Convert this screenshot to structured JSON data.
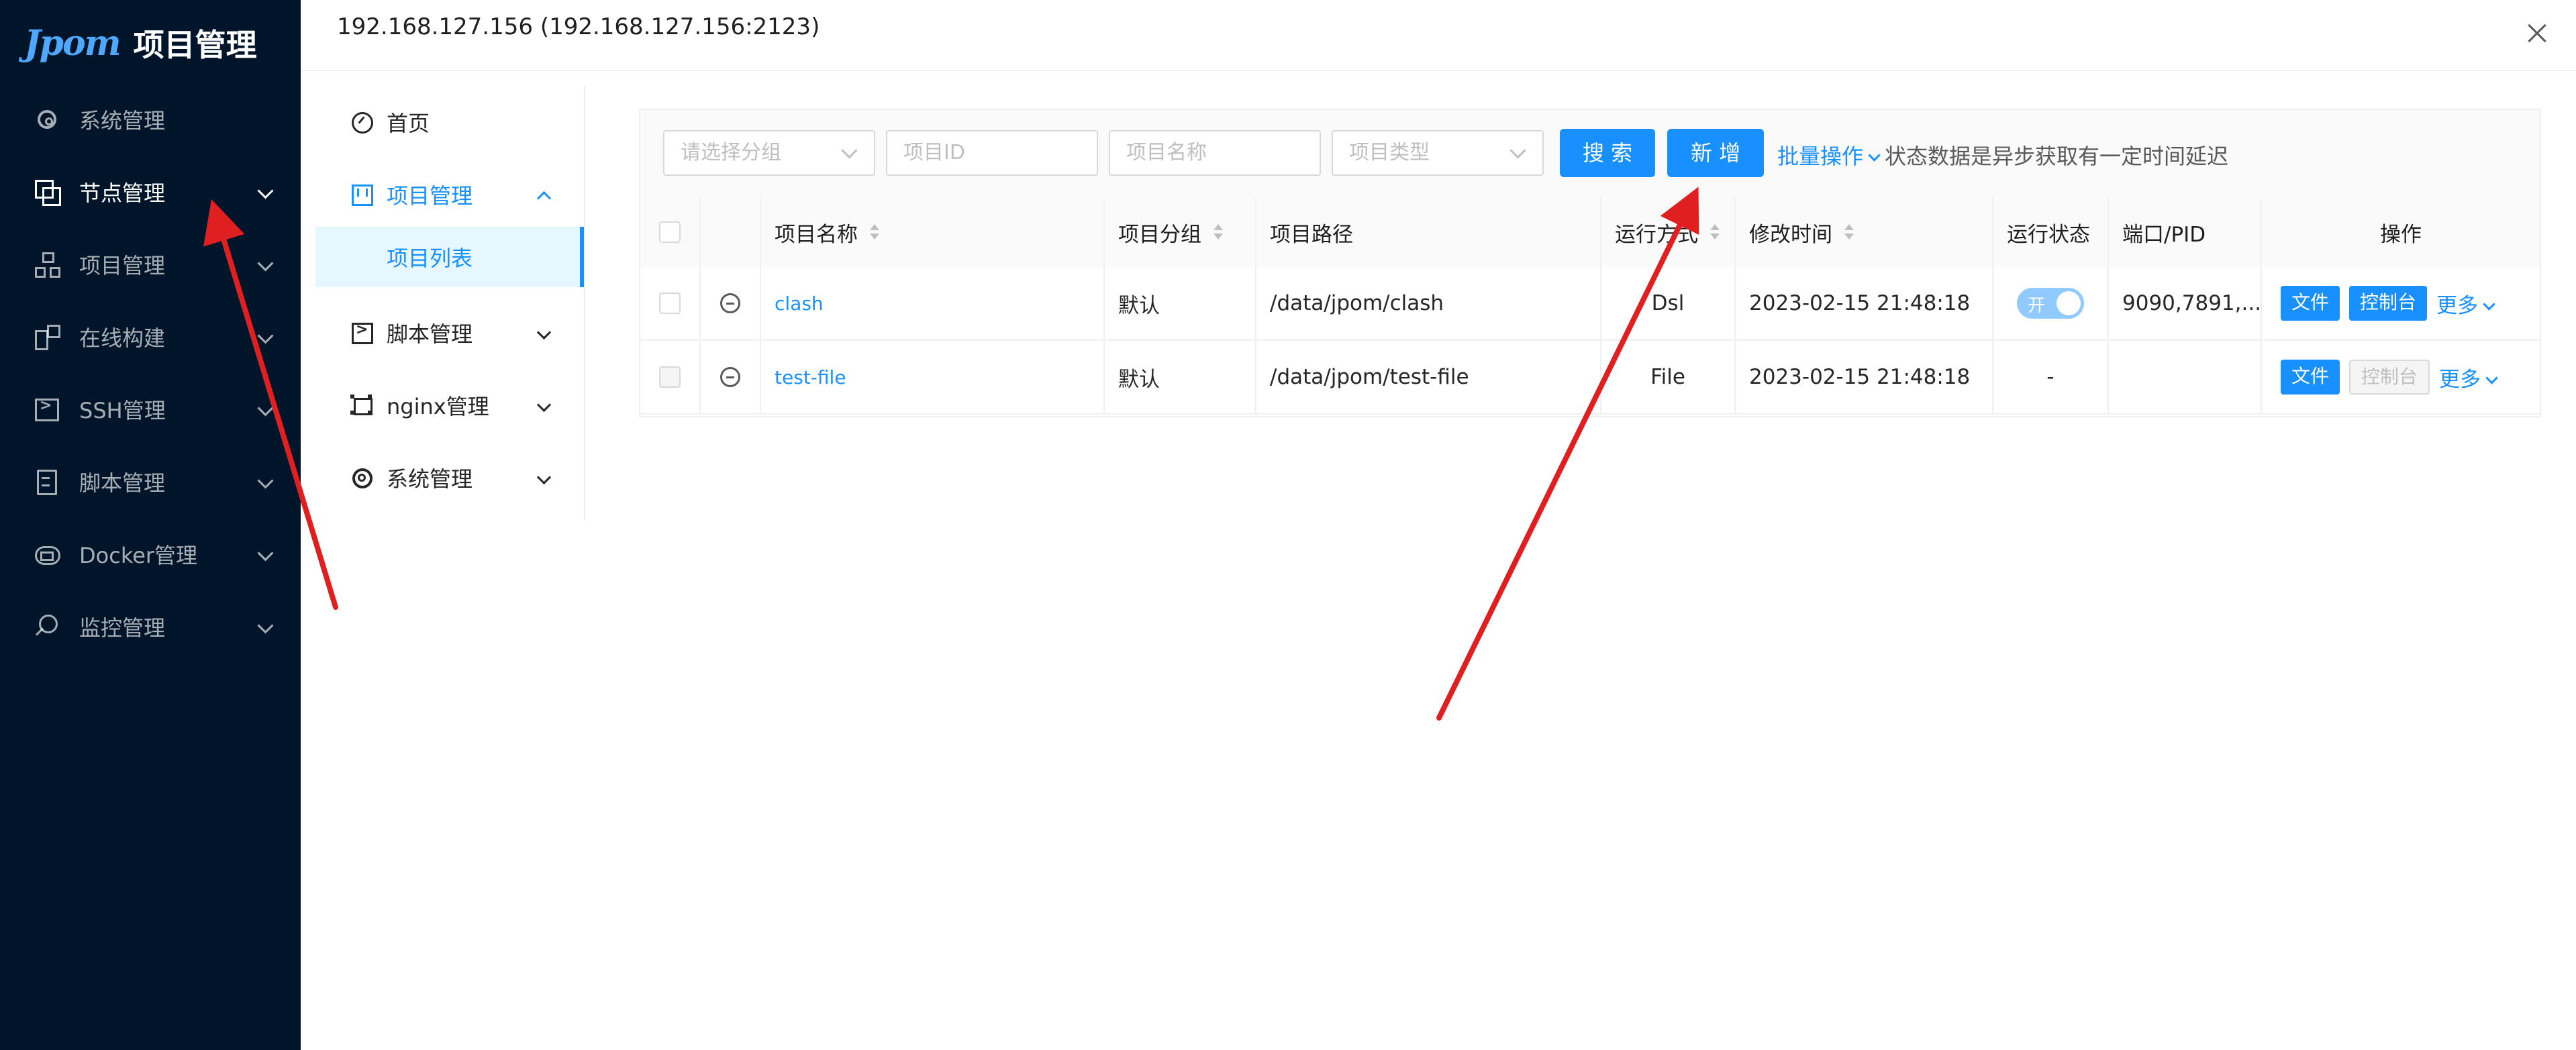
{
  "colors": {
    "sidebar_bg": "#001529",
    "accent": "#1890ff",
    "arrow": "#e02020"
  },
  "sidebar": {
    "logo_mark": "Jpom",
    "logo_title": "项目管理",
    "items": [
      {
        "label": "系统管理",
        "icon": "setting-icon"
      },
      {
        "label": "节点管理",
        "icon": "copy-icon"
      },
      {
        "label": "项目管理",
        "icon": "apartment-icon"
      },
      {
        "label": "在线构建",
        "icon": "build-icon"
      },
      {
        "label": "SSH管理",
        "icon": "code-icon"
      },
      {
        "label": "脚本管理",
        "icon": "file-text-icon"
      },
      {
        "label": "Docker管理",
        "icon": "cloud-server-icon"
      },
      {
        "label": "监控管理",
        "icon": "monitor-icon"
      }
    ]
  },
  "panel": {
    "title": "192.168.127.156 (192.168.127.156:2123)"
  },
  "inner_menu": {
    "items": [
      {
        "label": "首页"
      },
      {
        "label": "项目管理"
      },
      {
        "label": "项目列表"
      },
      {
        "label": "脚本管理"
      },
      {
        "label": "nginx管理"
      },
      {
        "label": "系统管理"
      }
    ]
  },
  "filters": {
    "group_placeholder": "请选择分组",
    "id_placeholder": "项目ID",
    "name_placeholder": "项目名称",
    "type_placeholder": "项目类型",
    "search_label": "搜 索",
    "add_label": "新 增",
    "batch_label": "批量操作",
    "note": "状态数据是异步获取有一定时间延迟"
  },
  "table": {
    "headers": {
      "name": "项目名称",
      "group": "项目分组",
      "path": "项目路径",
      "run_mode": "运行方式",
      "modified": "修改时间",
      "status": "运行状态",
      "port": "端口/PID",
      "actions": "操作"
    },
    "rows": [
      {
        "name": "clash",
        "group": "默认",
        "path": "/data/jpom/clash",
        "run_mode": "Dsl",
        "modified": "2023-02-15 21:48:18",
        "status": "开",
        "port": "9090,7891,...",
        "file_btn": "文件",
        "console_btn": "控制台",
        "more": "更多"
      },
      {
        "name": "test-file",
        "group": "默认",
        "path": "/data/jpom/test-file",
        "run_mode": "File",
        "modified": "2023-02-15 21:48:18",
        "status": "-",
        "port": "",
        "file_btn": "文件",
        "console_btn": "控制台",
        "more": "更多"
      }
    ]
  }
}
